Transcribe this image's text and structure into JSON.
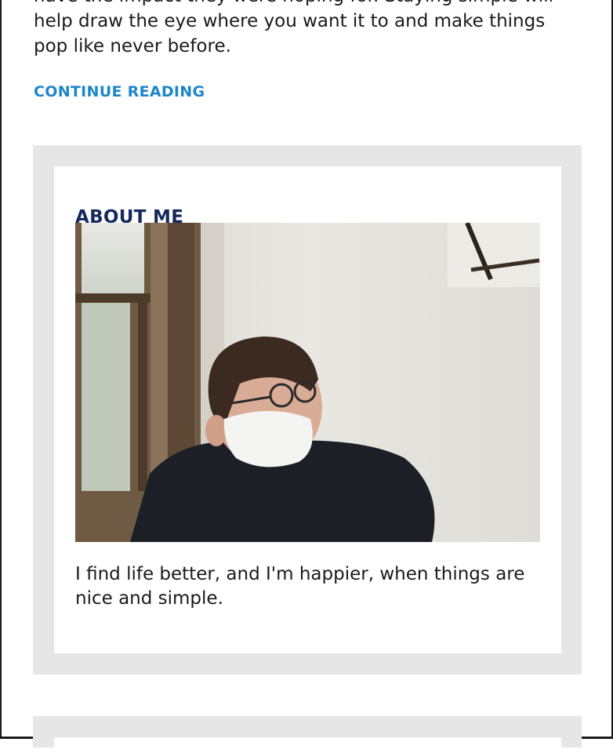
{
  "post": {
    "excerpt": "have the impact they were hoping for. Staying simple will help draw the eye where you want it to and make things pop like never before.",
    "continue_label": "CONTINUE READING"
  },
  "about_widget": {
    "title": "ABOUT ME",
    "text": "I find life better, and I'm happier, when things are nice and simple."
  },
  "colors": {
    "link": "#1d86c8",
    "widget_title": "#142a5c",
    "widget_background": "#e6e6e6",
    "body_text": "#1a1a1a"
  }
}
